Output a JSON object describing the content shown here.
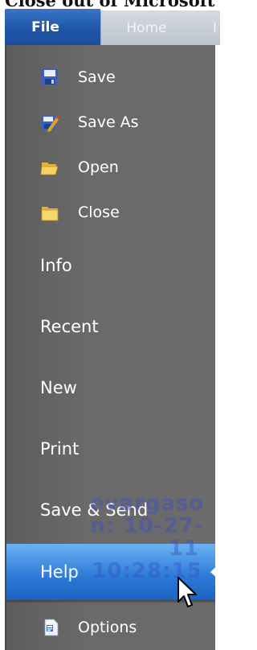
{
  "window": {
    "title": "Close out of Microsoft"
  },
  "tabs": [
    {
      "label": "File",
      "active": true
    },
    {
      "label": "Home",
      "active": false
    },
    {
      "label": "I",
      "active": false
    }
  ],
  "menu": {
    "save": {
      "label": "Save",
      "icon": "floppy-disk-icon"
    },
    "save_as": {
      "label": "Save As",
      "icon": "save-as-pencil-icon"
    },
    "open": {
      "label": "Open",
      "icon": "open-folder-icon"
    },
    "close": {
      "label": "Close",
      "icon": "closed-folder-icon"
    },
    "info": {
      "label": "Info"
    },
    "recent": {
      "label": "Recent"
    },
    "new": {
      "label": "New"
    },
    "print": {
      "label": "Print"
    },
    "save_send": {
      "label": "Save & Send"
    },
    "help": {
      "label": "Help",
      "selected": true
    },
    "options": {
      "label": "Options",
      "icon": "options-document-icon"
    }
  },
  "watermark": {
    "line1": "evargaso",
    "line2": "n: 10-27-",
    "line3": "11",
    "line4": "10:28:15"
  },
  "colors": {
    "file_tab": "#1f56a8",
    "panel_bg": "#666666",
    "help_highlight": "#2b78d6",
    "watermark": "#3c50c8"
  }
}
